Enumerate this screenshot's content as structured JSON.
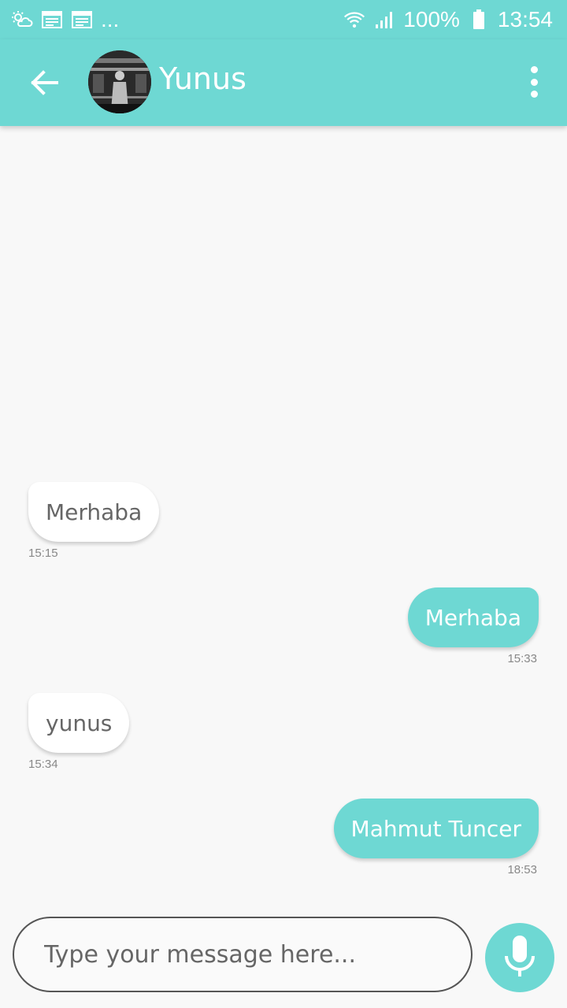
{
  "status_bar": {
    "more": "...",
    "battery": "100%",
    "time": "13:54"
  },
  "header": {
    "contact_name": "Yunus"
  },
  "messages": [
    {
      "text": "Merhaba",
      "time": "15:15",
      "direction": "incoming"
    },
    {
      "text": "Merhaba",
      "time": "15:33",
      "direction": "outgoing"
    },
    {
      "text": "yunus",
      "time": "15:34",
      "direction": "incoming"
    },
    {
      "text": "Mahmut Tuncer",
      "time": "18:53",
      "direction": "outgoing"
    }
  ],
  "composer": {
    "placeholder": "Type your message here..."
  },
  "colors": {
    "accent": "#6ed8d3",
    "background": "#f8f8f8"
  },
  "icons": {
    "back": "arrow-left-icon",
    "menu": "more-vert-icon",
    "mic": "microphone-icon"
  }
}
